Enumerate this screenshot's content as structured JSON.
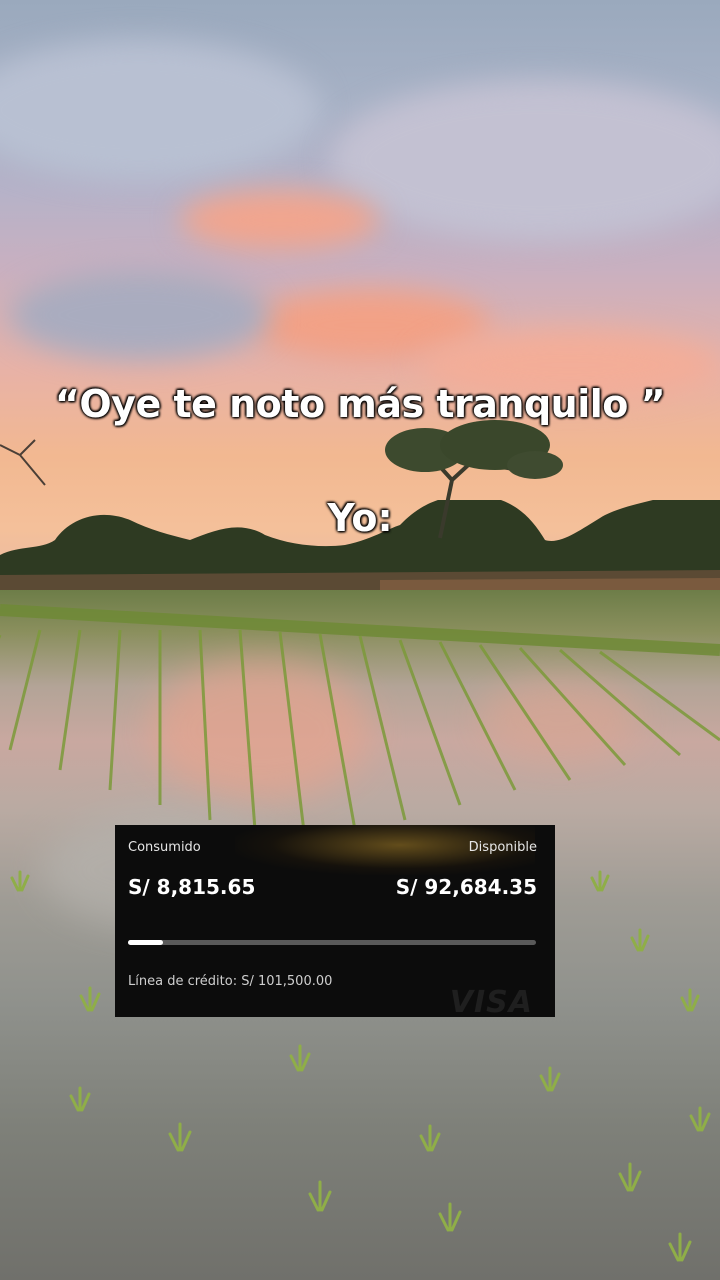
{
  "captions": {
    "line1": "“Oye te noto más tranquilo ”",
    "line2": "Yo:"
  },
  "card": {
    "consumed_label": "Consumido",
    "available_label": "Disponible",
    "consumed_amount": "S/ 8,815.65",
    "available_amount": "S/ 92,684.35",
    "usage_fraction": 0.087,
    "credit_line": "Línea de crédito: S/ 101,500.00",
    "brand": "VISA"
  }
}
